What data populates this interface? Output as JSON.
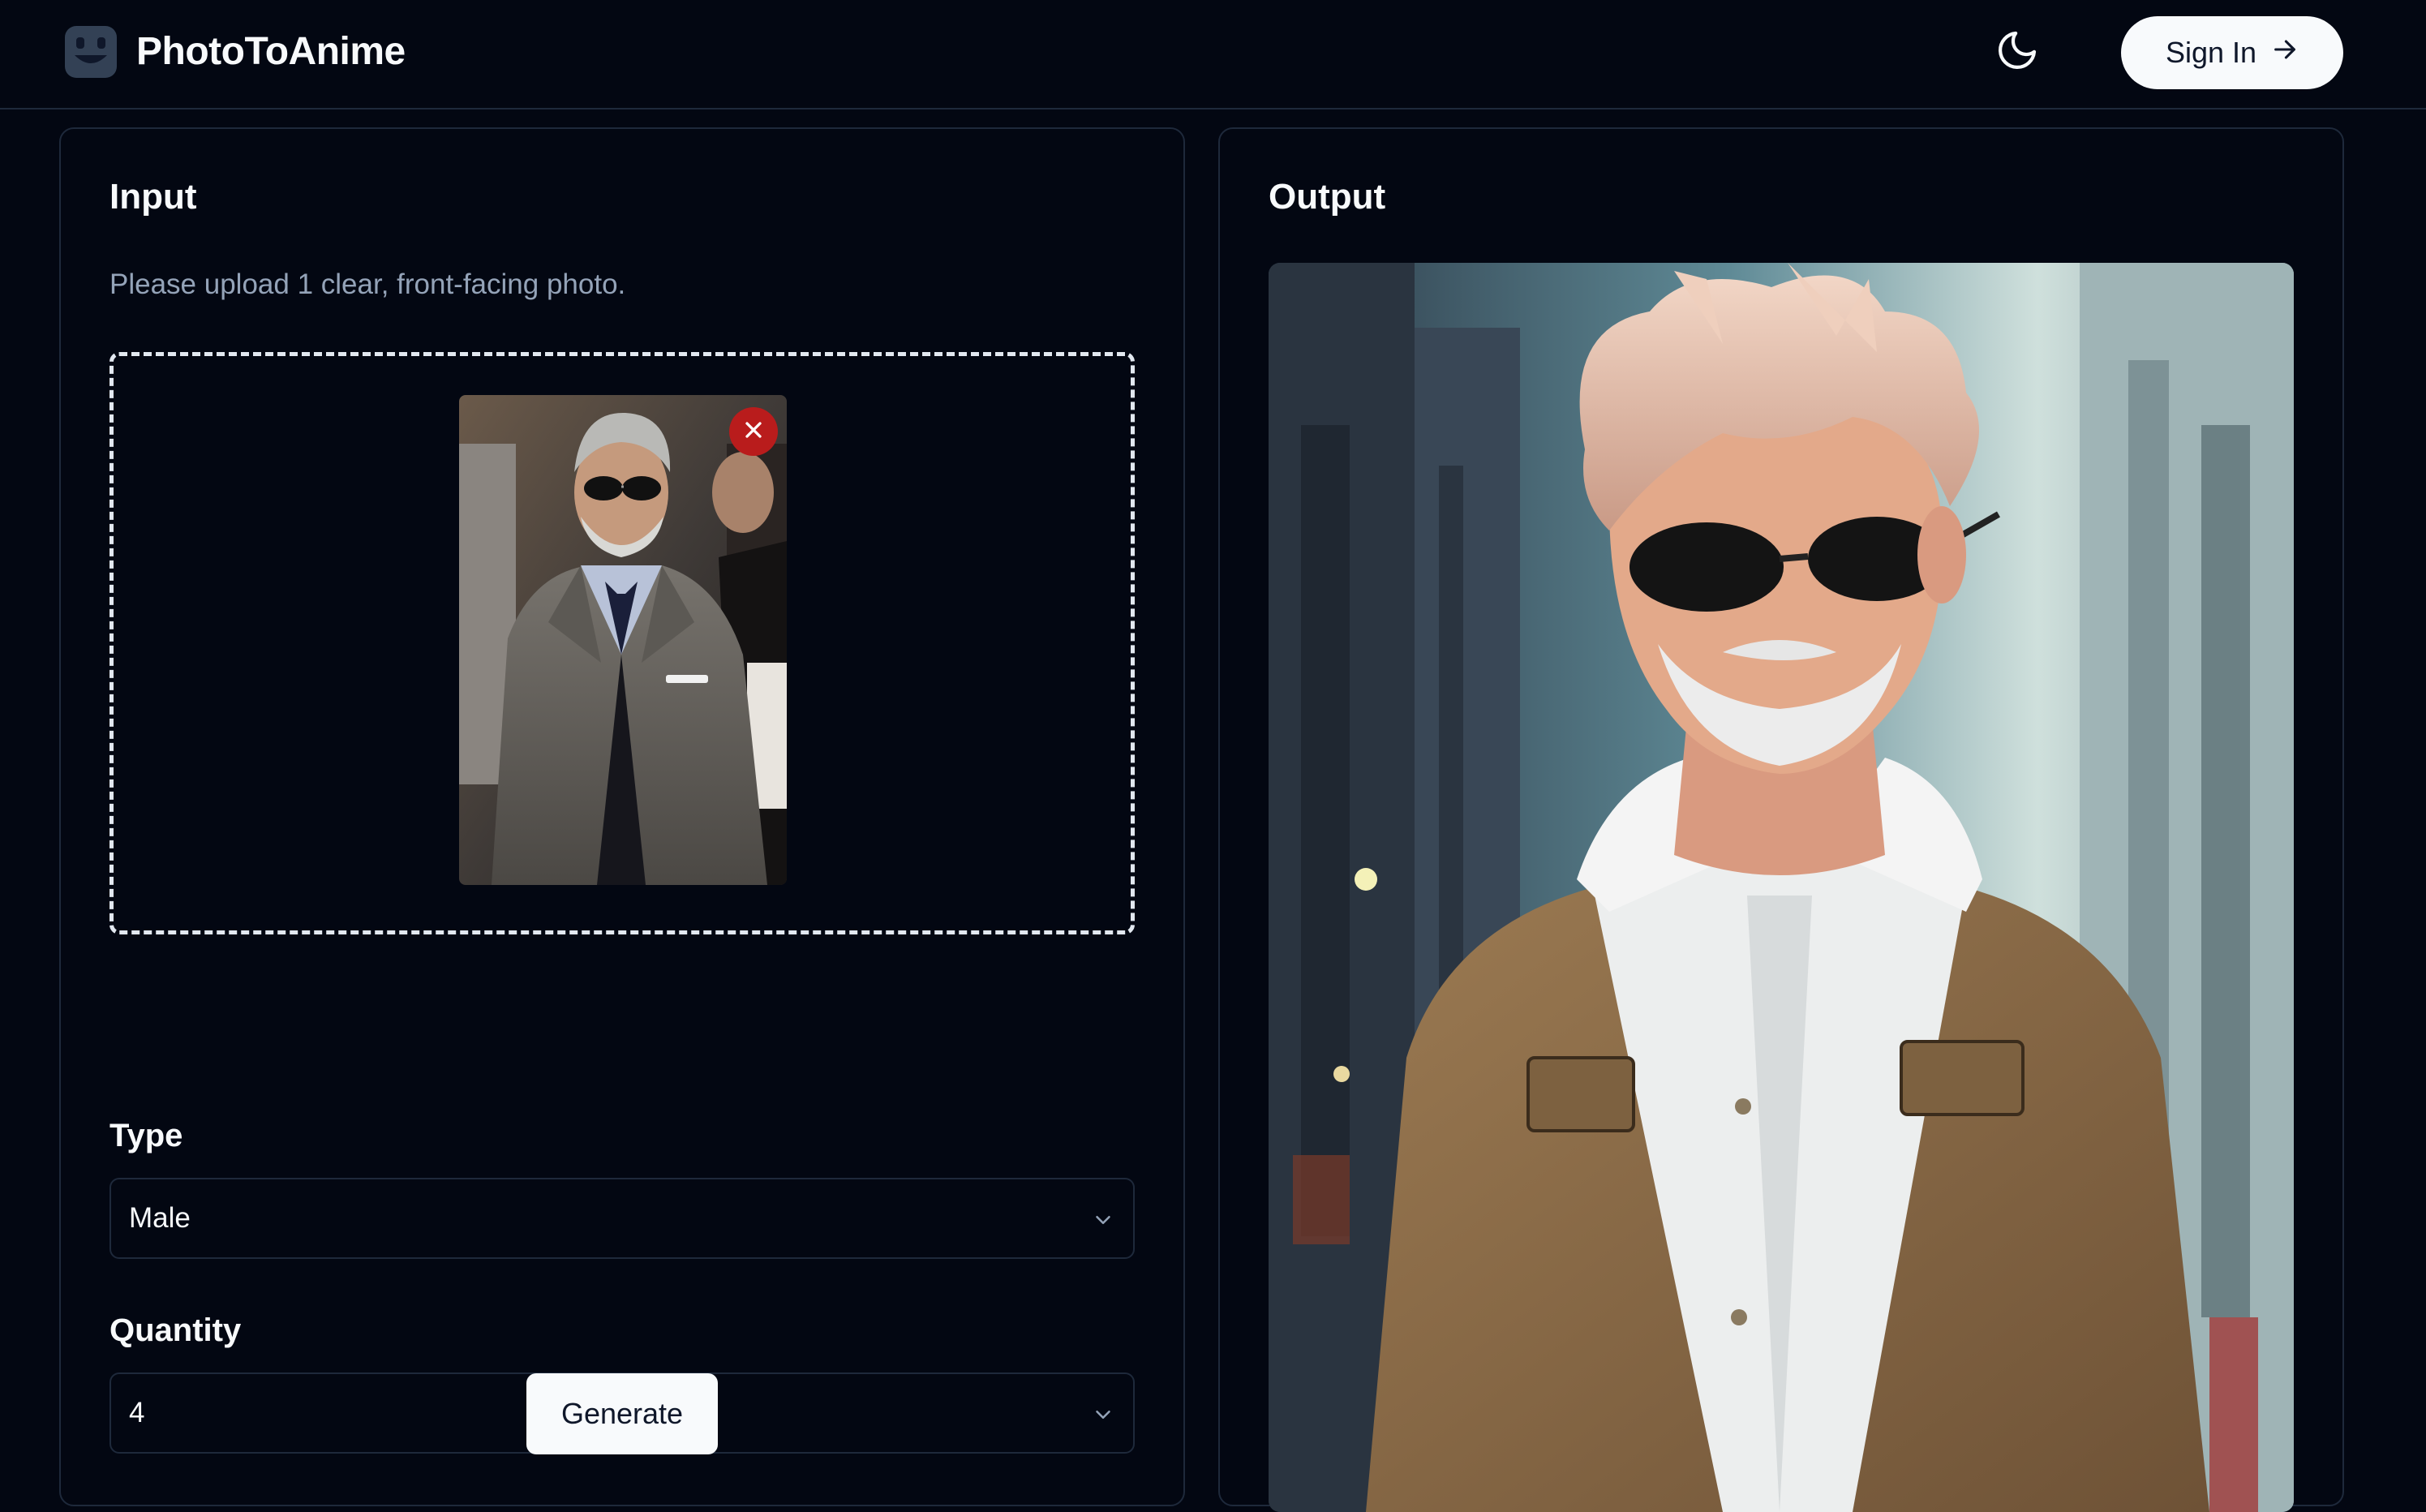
{
  "header": {
    "brand": "PhotoToAnime",
    "logo_icon": "smiley-face-logo-icon",
    "theme_icon": "moon-icon",
    "sign_in_label": "Sign In",
    "sign_in_icon": "arrow-right-icon"
  },
  "input_panel": {
    "title": "Input",
    "description": "Please upload 1 clear, front-facing photo.",
    "remove_icon": "close-icon",
    "type": {
      "label": "Type",
      "value": "Male"
    },
    "quantity": {
      "label": "Quantity",
      "value": "4"
    },
    "generate_label": "Generate"
  },
  "output_panel": {
    "title": "Output"
  },
  "colors": {
    "background": "#030712",
    "border": "#1e293b",
    "muted_text": "#94a3b8",
    "button_bg": "#f8fafc",
    "remove_button": "#b91c1c"
  }
}
